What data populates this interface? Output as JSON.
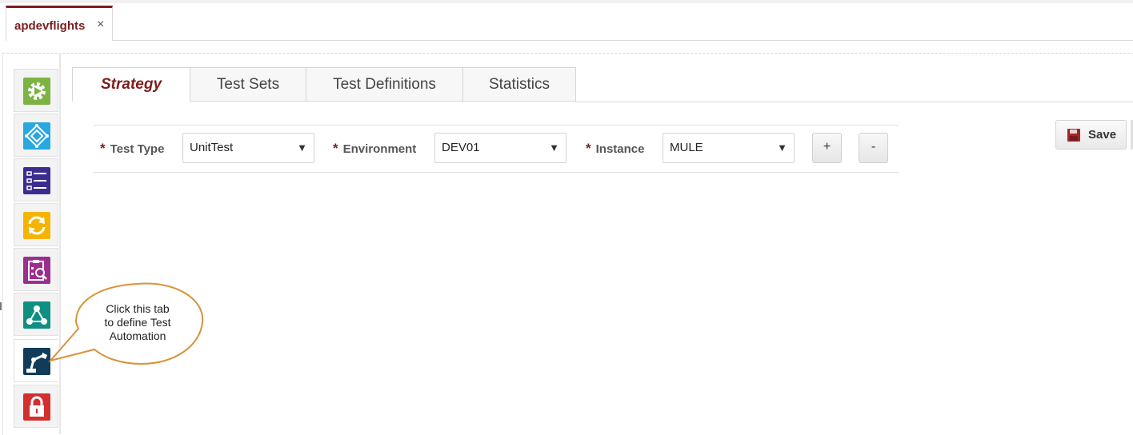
{
  "document_tab": {
    "title": "apdevflights",
    "close_glyph": "×"
  },
  "sidebar": {
    "items": [
      {
        "name": "run-gear-icon",
        "color": "#7cb342"
      },
      {
        "name": "diamond-network-icon",
        "color": "#29a8e0"
      },
      {
        "name": "list-icon",
        "color": "#3b2d8f"
      },
      {
        "name": "refresh-icon",
        "color": "#f5b400"
      },
      {
        "name": "clipboard-search-icon",
        "color": "#9b2f8f"
      },
      {
        "name": "share-nodes-icon",
        "color": "#0f8f82"
      },
      {
        "name": "robot-arm-icon",
        "color": "#123b5a"
      },
      {
        "name": "lock-icon",
        "color": "#d32f2f"
      }
    ]
  },
  "tabs": [
    {
      "label": "Strategy",
      "active": true
    },
    {
      "label": "Test Sets"
    },
    {
      "label": "Test Definitions"
    },
    {
      "label": "Statistics"
    }
  ],
  "form": {
    "required_marker": "*",
    "test_type": {
      "label": "Test Type",
      "value": "UnitTest"
    },
    "environment": {
      "label": "Environment",
      "value": "DEV01"
    },
    "instance": {
      "label": "Instance",
      "value": "MULE"
    },
    "add_label": "+",
    "remove_label": "-",
    "dropdown_arrow": "▼"
  },
  "toolbar": {
    "save_label": "Save"
  },
  "callout": {
    "lines": [
      "Click this tab",
      "to define Test",
      "Automation"
    ]
  },
  "colors": {
    "brand": "#7b1e1e",
    "callout_border": "#d9923a"
  }
}
